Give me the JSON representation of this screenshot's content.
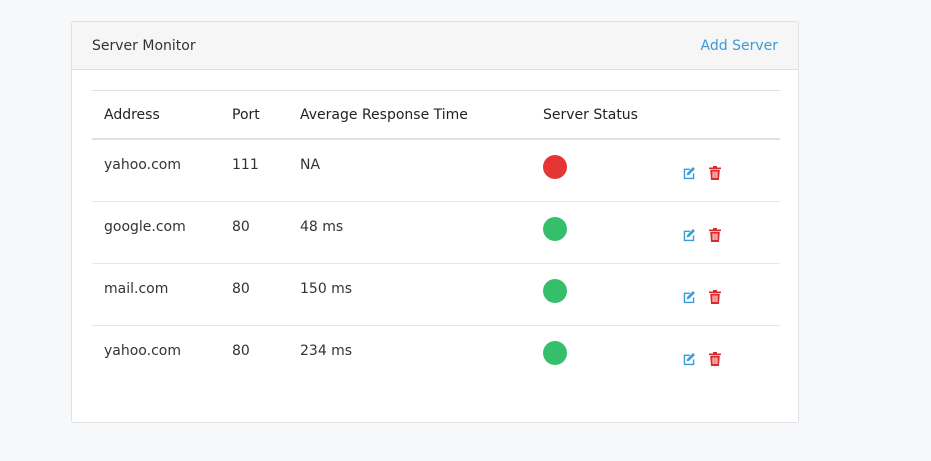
{
  "header": {
    "title": "Server Monitor",
    "add_label": "Add Server"
  },
  "table": {
    "columns": [
      "Address",
      "Port",
      "Average Response Time",
      "Server Status",
      ""
    ],
    "rows": [
      {
        "address": "yahoo.com",
        "port": "111",
        "response": "NA",
        "status": "down"
      },
      {
        "address": "google.com",
        "port": "80",
        "response": "48 ms",
        "status": "up"
      },
      {
        "address": "mail.com",
        "port": "80",
        "response": "150 ms",
        "status": "up"
      },
      {
        "address": "yahoo.com",
        "port": "80",
        "response": "234 ms",
        "status": "up"
      }
    ]
  },
  "colors": {
    "status_up": "#35bf6b",
    "status_down": "#e53535",
    "edit_icon": "#3b9bd6",
    "delete_icon": "#d92b2b",
    "link": "#3b9bd6"
  },
  "icons": {
    "edit": "edit-icon",
    "delete": "trash-icon"
  }
}
